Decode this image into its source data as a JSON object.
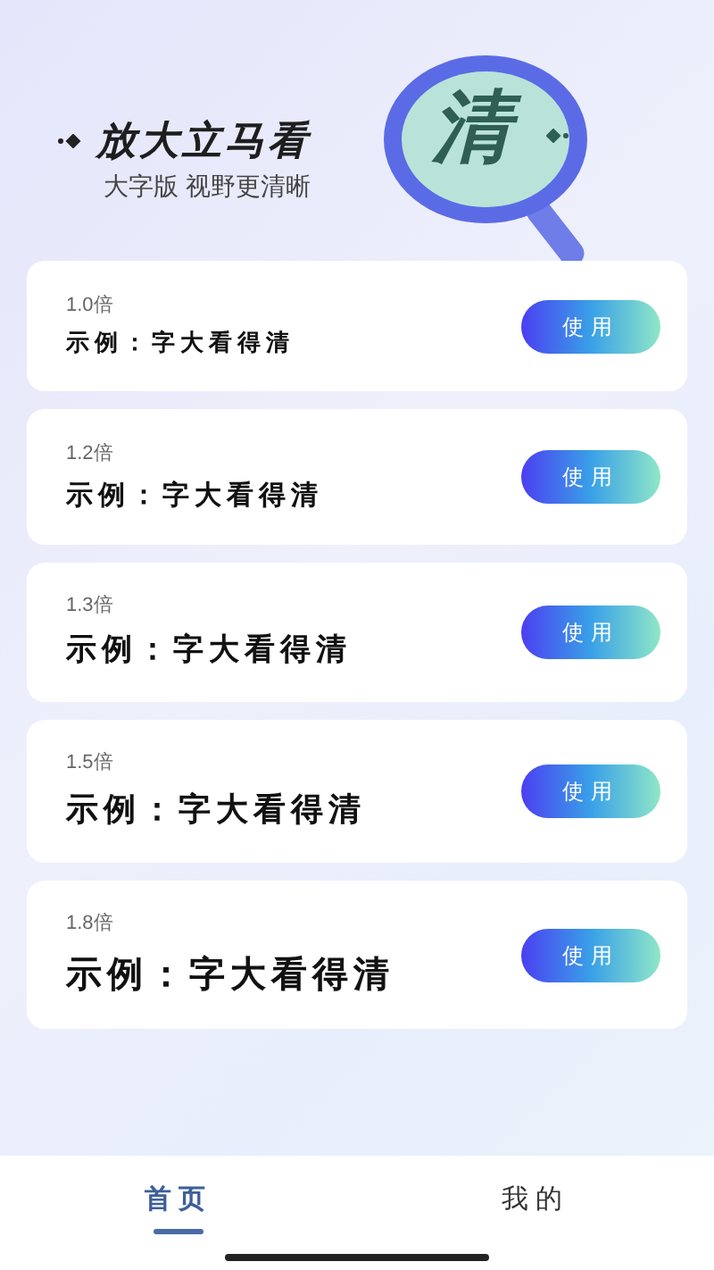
{
  "banner": {
    "title": "放大立马看",
    "lens_text": "清",
    "subtitle": "大字版 视野更清晰"
  },
  "options": [
    {
      "scale": "1.0倍",
      "sample": "示例：字大看得清",
      "button": "使用"
    },
    {
      "scale": "1.2倍",
      "sample": "示例：字大看得清",
      "button": "使用"
    },
    {
      "scale": "1.3倍",
      "sample": "示例：字大看得清",
      "button": "使用"
    },
    {
      "scale": "1.5倍",
      "sample": "示例：字大看得清",
      "button": "使用"
    },
    {
      "scale": "1.8倍",
      "sample": "示例：字大看得清",
      "button": "使用"
    }
  ],
  "tabs": [
    {
      "label": "首页",
      "selected": true
    },
    {
      "label": "我的",
      "selected": false
    }
  ]
}
